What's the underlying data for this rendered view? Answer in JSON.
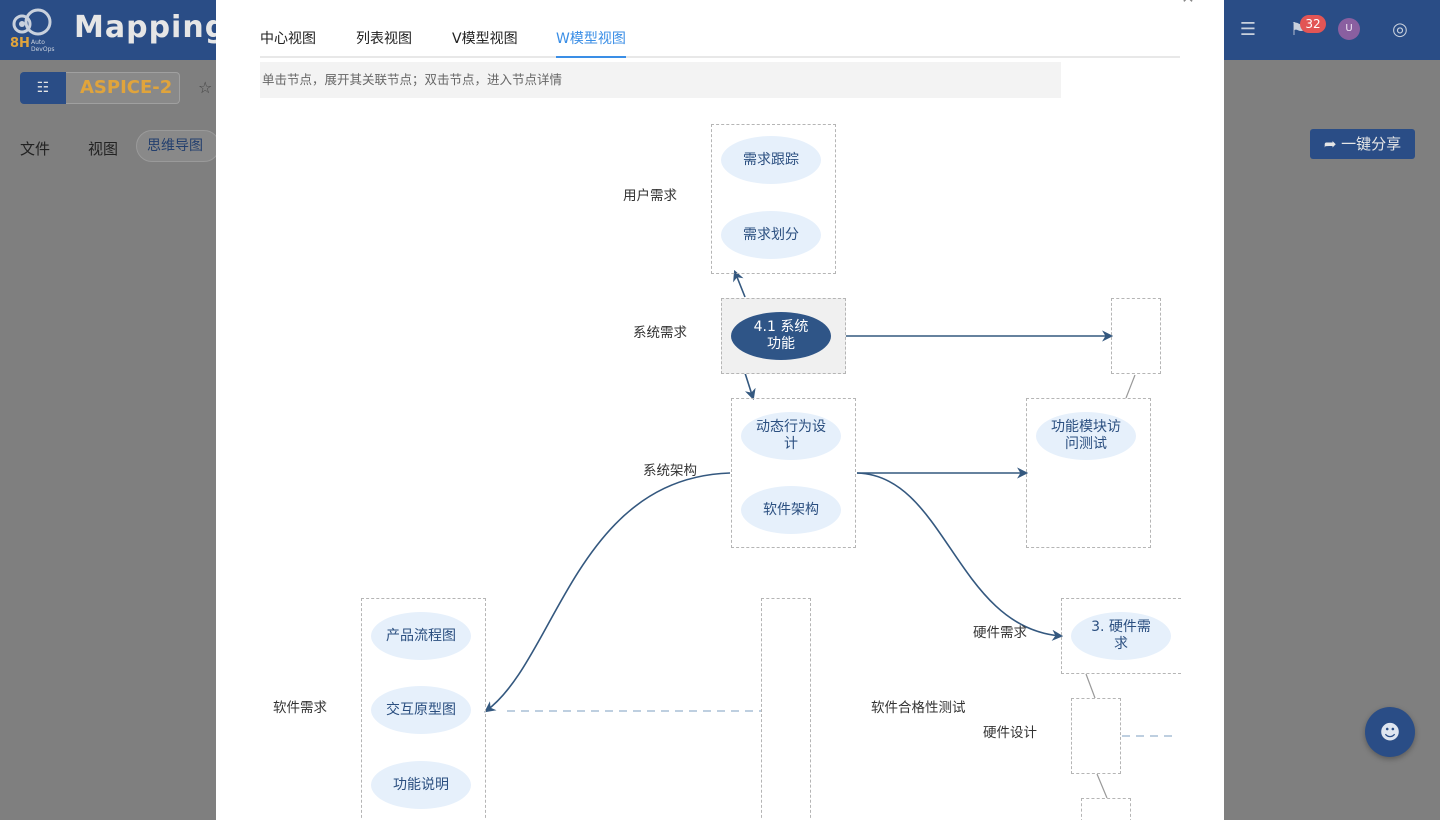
{
  "app": {
    "logo_badge": "8H",
    "logo_sub": "Auto DevOps",
    "logo_text": "MappingS",
    "notification_count": "32",
    "avatar_initial": "U"
  },
  "project": {
    "name": "ASPICE-2"
  },
  "menu": {
    "file": "文件",
    "view": "视图",
    "mindmap": "思维导图",
    "share": "一键分享"
  },
  "modal": {
    "tabs": [
      {
        "label": "中心视图"
      },
      {
        "label": "列表视图"
      },
      {
        "label": "V模型视图"
      },
      {
        "label": "W模型视图",
        "active": true
      }
    ],
    "hint": "单击节点，展开其关联节点；双击节点，进入节点详情"
  },
  "diagram": {
    "stages": {
      "user_req": "用户需求",
      "sys_req": "系统需求",
      "sys_arch": "系统架构",
      "sw_req": "软件需求",
      "hw_req": "硬件需求",
      "sw_conform_test": "软件合格性测试",
      "hw_design": "硬件设计"
    },
    "nodes": {
      "req_trace": "需求跟踪",
      "req_split": "需求划分",
      "sys_func": "4.1 系统功能",
      "dyn_design": "动态行为设计",
      "sw_arch": "软件架构",
      "func_test": "功能模块访问测试",
      "hw_req_node": "3. 硬件需求",
      "prod_flow": "产品流程图",
      "proto": "交互原型图",
      "func_desc": "功能说明"
    }
  },
  "colors": {
    "topbar": "#2a4d86",
    "accent_tab": "#3a8ee6",
    "node_fill": "#e6f0fb",
    "node_dark": "#2f5587",
    "edge": "#34587f"
  }
}
